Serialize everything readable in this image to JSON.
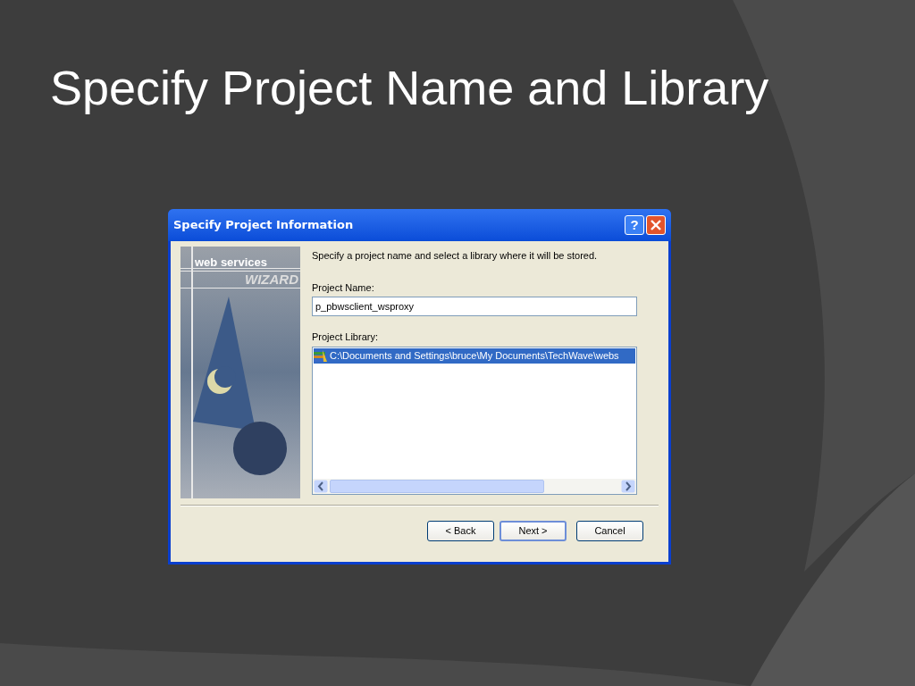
{
  "slide": {
    "title": "Specify Project Name and Library"
  },
  "dialog": {
    "title": "Specify Project Information",
    "help_button": "?",
    "wizard_banner": {
      "line_1": "web services",
      "line_2": "WIZARD"
    },
    "instruction": "Specify a project name and select a library where it will be stored.",
    "project_name": {
      "label": "Project Name:",
      "value": "p_pbwsclient_wsproxy"
    },
    "project_library": {
      "label": "Project Library:",
      "items": [
        {
          "text": "C:\\Documents and Settings\\bruce\\My Documents\\TechWave\\webs",
          "selected": true
        }
      ]
    },
    "buttons": [
      {
        "label": "< Back",
        "default": false
      },
      {
        "label": "Next >",
        "default": true
      },
      {
        "label": "Cancel",
        "default": false
      }
    ]
  }
}
